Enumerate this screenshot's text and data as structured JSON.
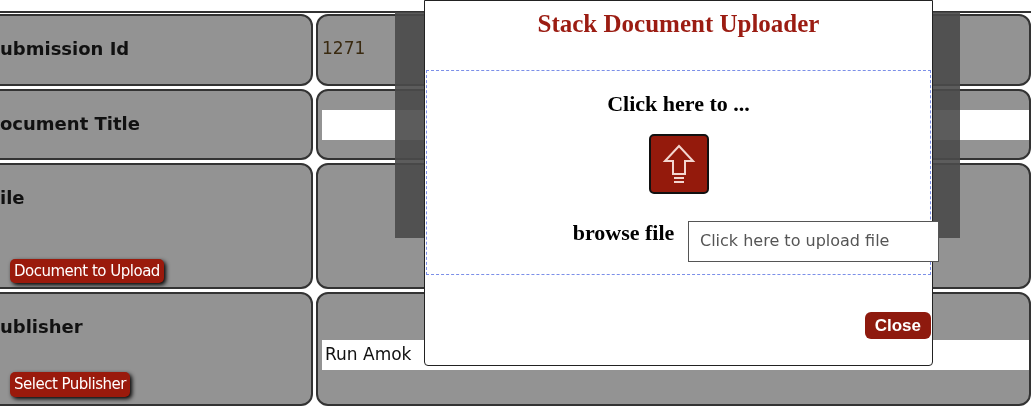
{
  "form": {
    "rows": [
      {
        "kind": "text",
        "label": "ubmission Id",
        "value": "1271"
      },
      {
        "kind": "input",
        "label": "ocument Title",
        "value": ""
      },
      {
        "kind": "button",
        "label": "ile",
        "button": "Document to Upload"
      },
      {
        "kind": "input-button",
        "label": "ublisher",
        "value": "Run Amok",
        "button": "Select Publisher"
      }
    ]
  },
  "dialog": {
    "title": "Stack Document Uploader",
    "drop_heading": "Click here to ...",
    "drop_footer": "browse file",
    "tooltip": "Click here to upload file",
    "close_button": "Close"
  }
}
